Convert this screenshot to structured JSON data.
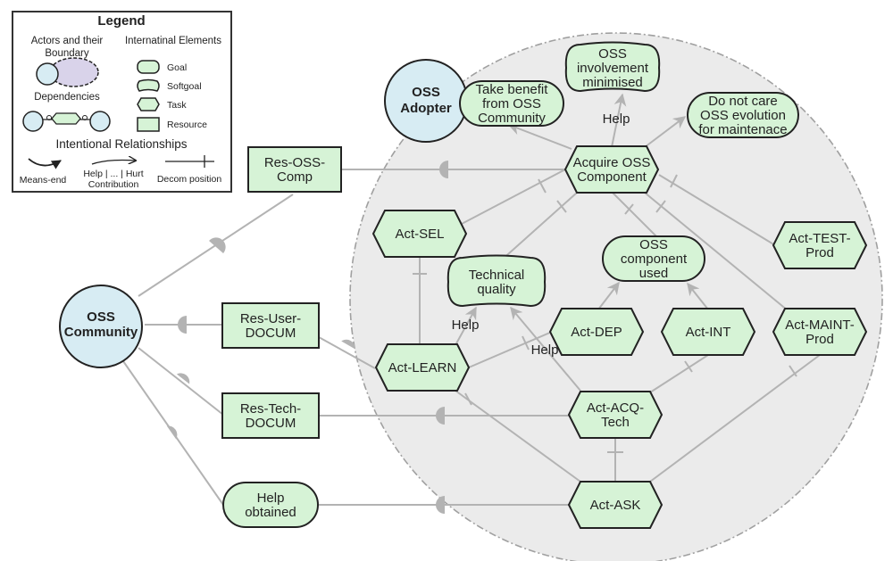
{
  "legend": {
    "title": "Legend",
    "actors_heading_1": "Actors and their",
    "actors_heading_2": "Boundary",
    "elements_heading": "Internatinal Elements",
    "dependencies_heading": "Dependencies",
    "elements": [
      {
        "type": "goal",
        "label": "Goal"
      },
      {
        "type": "softgoal",
        "label": "Softgoal"
      },
      {
        "type": "task",
        "label": "Task"
      },
      {
        "type": "resource",
        "label": "Resource"
      }
    ],
    "relationships_heading": "Intentional Relationships",
    "means_end": "Means-end",
    "contribution_1": "Help | ... | Hurt",
    "contribution_2": "Contribution",
    "decomposition": "Decom position"
  },
  "colors": {
    "actor_fill": "#d7ecf3",
    "element_fill": "#d6f3d6",
    "boundary_fill": "#ebebeb",
    "link": "#b3b3b3",
    "outline": "#222222"
  },
  "actors": {
    "community": {
      "line1": "OSS",
      "line2": "Community"
    },
    "adopter": {
      "line1": "OSS",
      "line2": "Adopter"
    }
  },
  "nodes": {
    "take_benefit": {
      "type": "goal",
      "lines": [
        "Take benefit",
        "from OSS",
        "Community"
      ]
    },
    "involvement": {
      "type": "softgoal",
      "lines": [
        "OSS",
        "involvement",
        "minimised"
      ]
    },
    "do_not_care": {
      "type": "goal",
      "lines": [
        "Do not care",
        "OSS evolution",
        "for maintenace"
      ]
    },
    "acquire": {
      "type": "task",
      "lines": [
        "Acquire OSS",
        "Component"
      ]
    },
    "res_oss_comp": {
      "type": "resource",
      "lines": [
        "Res-OSS-",
        "Comp"
      ]
    },
    "act_sel": {
      "type": "task",
      "lines": [
        "Act-SEL"
      ]
    },
    "tech_quality": {
      "type": "softgoal",
      "lines": [
        "Technical",
        "quality"
      ]
    },
    "comp_used": {
      "type": "goal",
      "lines": [
        "OSS",
        "component",
        "used"
      ]
    },
    "act_test": {
      "type": "task",
      "lines": [
        "Act-TEST-",
        "Prod"
      ]
    },
    "res_user_docum": {
      "type": "resource",
      "lines": [
        "Res-User-",
        "DOCUM"
      ]
    },
    "act_learn": {
      "type": "task",
      "lines": [
        "Act-LEARN"
      ]
    },
    "act_dep": {
      "type": "task",
      "lines": [
        "Act-DEP"
      ]
    },
    "act_int": {
      "type": "task",
      "lines": [
        "Act-INT"
      ]
    },
    "act_maint": {
      "type": "task",
      "lines": [
        "Act-MAINT-",
        "Prod"
      ]
    },
    "res_tech_docum": {
      "type": "resource",
      "lines": [
        "Res-Tech-",
        "DOCUM"
      ]
    },
    "act_acq_tech": {
      "type": "task",
      "lines": [
        "Act-ACQ-",
        "Tech"
      ]
    },
    "help_obtained": {
      "type": "goal",
      "lines": [
        "Help",
        "obtained"
      ]
    },
    "act_ask": {
      "type": "task",
      "lines": [
        "Act-ASK"
      ]
    }
  },
  "labels": {
    "help_involvement": "Help",
    "help_learn": "Help",
    "help_acq": "Help"
  }
}
